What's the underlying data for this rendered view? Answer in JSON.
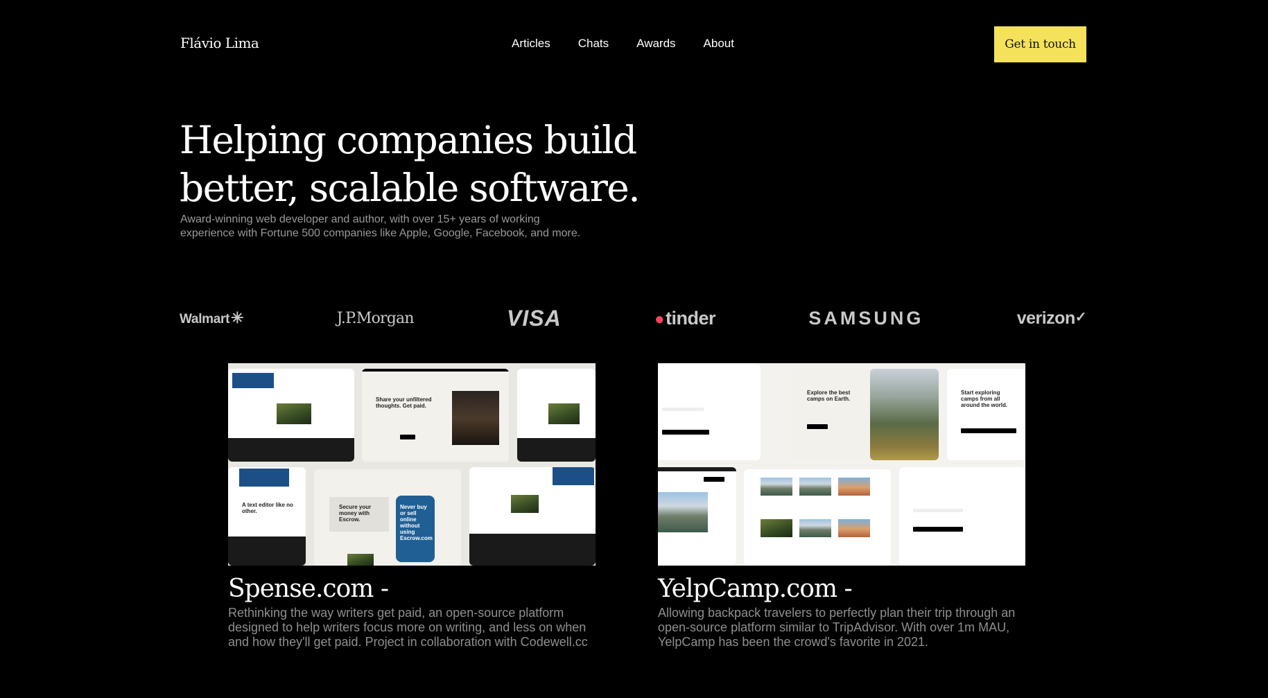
{
  "header": {
    "brand": "Flávio Lima",
    "nav": [
      "Articles",
      "Chats",
      "Awards",
      "About"
    ],
    "cta": "Get in touch"
  },
  "hero": {
    "title": "Helping companies build better, scalable software.",
    "subtitle": "Award-winning web developer and author, with over 15+ years of working experience with Fortune 500 companies like Apple, Google, Facebook, and more."
  },
  "clients": {
    "walmart": "Walmart",
    "jpmorgan": "J.P.Morgan",
    "visa": "VISA",
    "tinder": "tinder",
    "samsung": "SAMSUNG",
    "verizon": "verizon"
  },
  "projects": [
    {
      "title": "Spense.com -",
      "description": "Rethinking the way writers get paid, an open-source platform designed to help writers focus more on writing, and less on when and how they'll get paid. Project in collaboration with Codewell.cc",
      "shot": {
        "headline": "Share your unfiltered thoughts. Get paid.",
        "escrow_headline": "Never buy or sell online without using Escrow.com",
        "editor_headline": "A text editor like no other.",
        "money_headline": "Secure your money with Escrow."
      }
    },
    {
      "title": "YelpCamp.com -",
      "description": "Allowing backpack travelers to perfectly plan their trip through an open-source platform similar to TripAdvisor. With over 1m MAU, YelpCamp has been the crowd's favorite in 2021.",
      "shot": {
        "headline": "Explore the best camps on Earth.",
        "start_headline": "Start exploring camps from all around the world."
      }
    }
  ]
}
